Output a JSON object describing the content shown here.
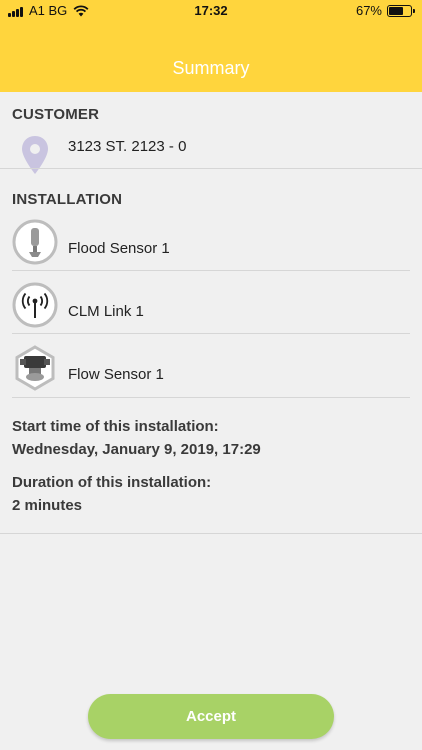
{
  "status_bar": {
    "carrier": "A1 BG",
    "time": "17:32",
    "battery": "67%",
    "battery_level": 0.67
  },
  "header": {
    "title": "Summary"
  },
  "customer": {
    "heading": "CUSTOMER",
    "address": "3123 ST. 2123 - 0",
    "icon": "location-pin-icon"
  },
  "installation": {
    "heading": "INSTALLATION",
    "devices": [
      {
        "name": "Flood Sensor 1",
        "icon": "flood-sensor-icon"
      },
      {
        "name": "CLM Link 1",
        "icon": "clm-link-icon"
      },
      {
        "name": "Flow Sensor 1",
        "icon": "flow-sensor-icon"
      }
    ]
  },
  "details": {
    "start_label": "Start time of this installation:",
    "start_value": "Wednesday, January 9, 2019, 17:29",
    "duration_label": "Duration of this installation:",
    "duration_value": "2 minutes"
  },
  "actions": {
    "accept_label": "Accept"
  },
  "colors": {
    "header": "#ffd53d",
    "accept": "#a8d266",
    "pin": "#c9c4e0"
  }
}
